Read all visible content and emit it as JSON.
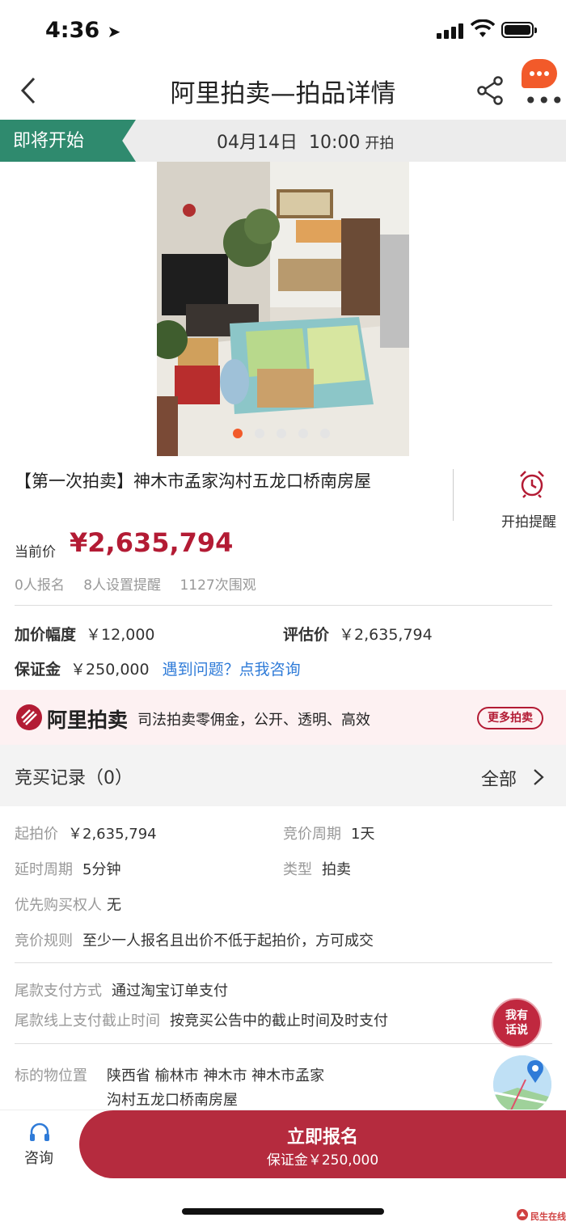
{
  "status_bar": {
    "time": "4:36"
  },
  "nav": {
    "title": "阿里拍卖—拍品详情"
  },
  "banner": {
    "badge": "即将开始",
    "date": "04月14日",
    "time": "10:00",
    "suffix": "开拍"
  },
  "item": {
    "title": "【第一次拍卖】神木市孟家沟村五龙口桥南房屋",
    "reminder_label": "开拍提醒",
    "gallery": {
      "total_images": 5,
      "active_index": 0
    }
  },
  "price": {
    "label": "当前价",
    "value": "¥2,635,794",
    "stats": [
      "0人报名",
      "8人设置提醒",
      "1127次围观"
    ]
  },
  "info": {
    "increment_label": "加价幅度",
    "increment_value": "￥12,000",
    "appraisal_label": "评估价",
    "appraisal_value": "￥2,635,794",
    "deposit_label": "保证金",
    "deposit_value": "￥250,000",
    "help_link": "遇到问题？点我咨询"
  },
  "ali_strip": {
    "logo_text": "阿里拍卖",
    "slogan": "司法拍卖零佣金，公开、透明、高效",
    "more_button": "更多拍卖"
  },
  "records": {
    "title": "竞买记录（0）",
    "all_label": "全部"
  },
  "details": {
    "start_price_label": "起拍价",
    "start_price_value": "￥2,635,794",
    "cycle_label": "竞价周期",
    "cycle_value": "1天",
    "delay_label": "延时周期",
    "delay_value": "5分钟",
    "type_label": "类型",
    "type_value": "拍卖",
    "priority_label": "优先购买权人",
    "priority_value": "无",
    "rule_label": "竞价规则",
    "rule_value": "至少一人报名且出价不低于起拍价，方可成交",
    "payment_label": "尾款支付方式",
    "payment_value": "通过淘宝订单支付",
    "deadline_label": "尾款线上支付截止时间",
    "deadline_value": "按竞买公告中的截止时间及时支付",
    "location_label": "标的物位置",
    "location_line1": "陕西省 榆林市 神木市 神木市孟家",
    "location_line2": "沟村五龙口桥南房屋"
  },
  "talk_button": {
    "line1": "我有",
    "line2": "话说"
  },
  "bottom": {
    "consult_label": "咨询",
    "apply_title": "立即报名",
    "apply_sub": "保证金￥250,000"
  },
  "watermark": "民生在线",
  "colors": {
    "accent": "#b31b34",
    "badge_green": "#2f8a6e",
    "orange": "#f25a2a",
    "link": "#2f7bd8"
  }
}
